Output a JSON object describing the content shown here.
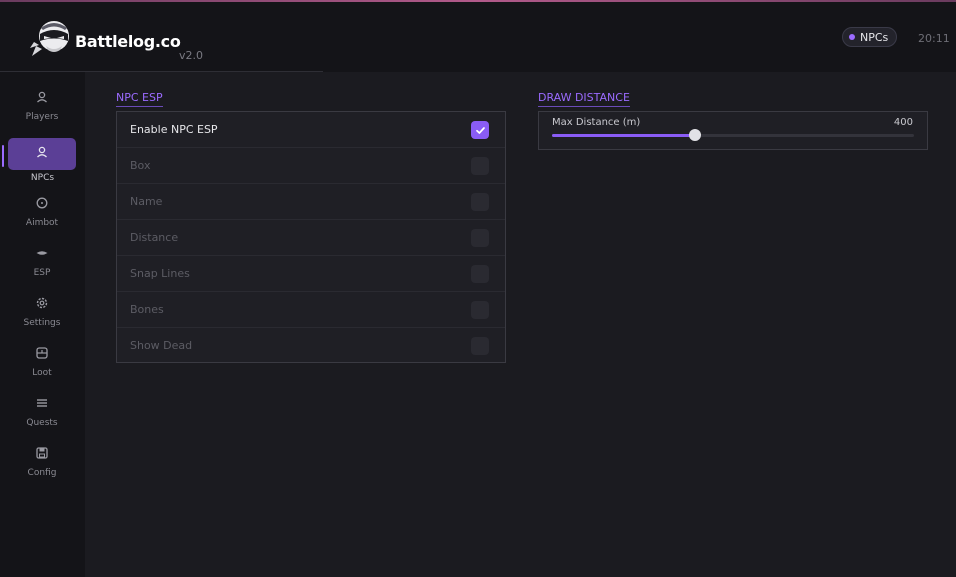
{
  "header": {
    "brand": "Battlelog.co",
    "version": "v2.0",
    "active_pill": "NPCs",
    "time": "20:11"
  },
  "sidebar": {
    "items": [
      {
        "label": "Players",
        "icon": "user-icon",
        "active": false
      },
      {
        "label": "NPCs",
        "icon": "npc-icon",
        "active": true
      },
      {
        "label": "Aimbot",
        "icon": "crosshair-icon",
        "active": false
      },
      {
        "label": "ESP",
        "icon": "eye-icon",
        "active": false
      },
      {
        "label": "Settings",
        "icon": "gear-icon",
        "active": false
      },
      {
        "label": "Loot",
        "icon": "loot-box-icon",
        "active": false
      },
      {
        "label": "Quests",
        "icon": "list-icon",
        "active": false
      },
      {
        "label": "Config",
        "icon": "save-icon",
        "active": false
      }
    ]
  },
  "npc_esp": {
    "title": "NPC ESP",
    "options": [
      {
        "label": "Enable NPC ESP",
        "checked": true
      },
      {
        "label": "Box",
        "checked": false
      },
      {
        "label": "Name",
        "checked": false
      },
      {
        "label": "Distance",
        "checked": false
      },
      {
        "label": "Snap Lines",
        "checked": false
      },
      {
        "label": "Bones",
        "checked": false
      },
      {
        "label": "Show Dead",
        "checked": false
      }
    ]
  },
  "draw_distance": {
    "title": "DRAW DISTANCE",
    "slider": {
      "label": "Max Distance (m)",
      "value": "400",
      "fraction": 0.395
    }
  },
  "colors": {
    "accent": "#8a5cf6",
    "active_nav": "#5b3f96",
    "background": "#1b1b20"
  }
}
